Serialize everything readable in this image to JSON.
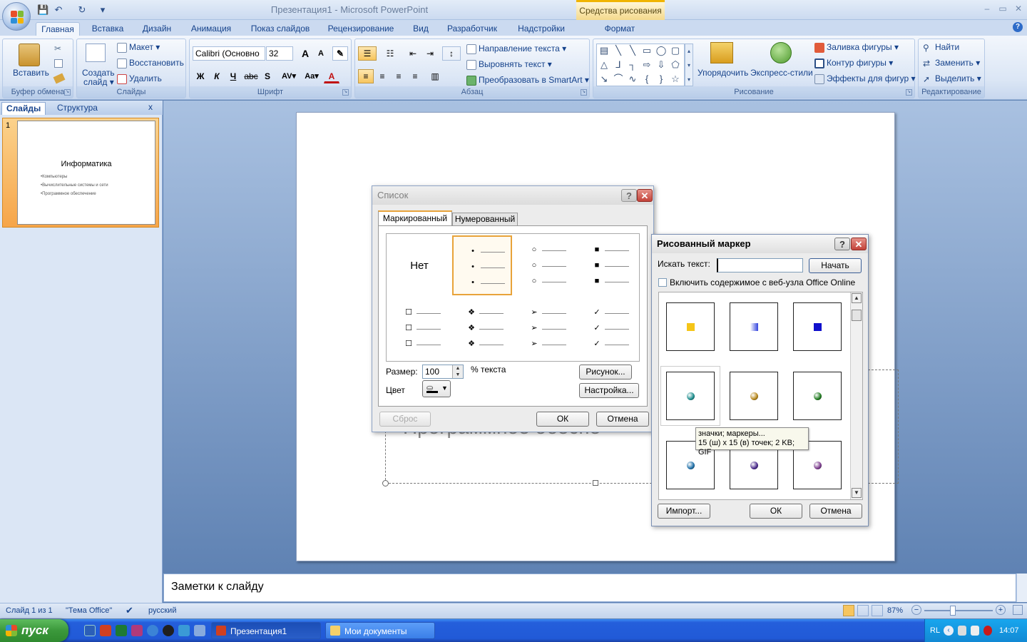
{
  "app": {
    "title": "Презентация1 - Microsoft PowerPoint",
    "context_tab": "Средства рисования",
    "win_min": "–",
    "win_max": "▭",
    "win_close": "✕",
    "help": "?"
  },
  "qat": {
    "save": "💾",
    "undo": "↶",
    "redo": "↻",
    "more": "▾"
  },
  "tabs": [
    {
      "label": "Главная",
      "active": true
    },
    {
      "label": "Вставка"
    },
    {
      "label": "Дизайн"
    },
    {
      "label": "Анимация"
    },
    {
      "label": "Показ слайдов"
    },
    {
      "label": "Рецензирование"
    },
    {
      "label": "Вид"
    },
    {
      "label": "Разработчик"
    },
    {
      "label": "Надстройки"
    },
    {
      "label": "Формат"
    }
  ],
  "ribbon": {
    "clipboard": {
      "label": "Буфер обмена",
      "paste": "Вставить"
    },
    "slides": {
      "label": "Слайды",
      "new_slide": "Создать",
      "new_slide2": "слайд ▾",
      "layout": "Макет ▾",
      "reset": "Восстановить",
      "delete": "Удалить"
    },
    "font": {
      "label": "Шрифт",
      "font_name": "Calibri (Основно",
      "font_size": "32",
      "bold": "Ж",
      "italic": "К",
      "underline": "Ч",
      "strike": "abc",
      "shadow": "S",
      "spacing": "AV▾",
      "case": "Aa▾",
      "color": "A",
      "grow": "A",
      "shrink": "A"
    },
    "paragraph": {
      "label": "Абзац",
      "text_direction": "Направление текста ▾",
      "align_text": "Выровнять текст ▾",
      "smartart": "Преобразовать в SmartArt ▾"
    },
    "drawing": {
      "label": "Рисование",
      "arrange": "Упорядочить",
      "quick_styles": "Экспресс-стили",
      "shape_fill": "Заливка фигуры ▾",
      "shape_outline": "Контур фигуры ▾",
      "shape_effects": "Эффекты для фигур ▾"
    },
    "editing": {
      "label": "Редактирование",
      "find": "Найти",
      "replace": "Заменить ▾",
      "select": "Выделить ▾"
    }
  },
  "left_panel": {
    "tab_slides": "Слайды",
    "tab_outline": "Структура",
    "close": "x",
    "slide_number": "1",
    "thumb_title": "Информатика",
    "thumb_bullets": [
      "•Компьютеры",
      "•Вычислительные системы и сети",
      "•Программное обеспечение"
    ]
  },
  "slide": {
    "visible_text": "Программное обеспе"
  },
  "notes": {
    "placeholder": "Заметки к слайду"
  },
  "status": {
    "slide": "Слайд 1 из 1",
    "theme": "\"Тема Office\"",
    "language": "русский",
    "zoom": "87%",
    "zoom_minus": "−",
    "zoom_plus": "+"
  },
  "bullets_dialog": {
    "title": "Список",
    "help": "?",
    "close": "✕",
    "tab_bulleted": "Маркированный",
    "tab_numbered": "Нумерованный",
    "none_label": "Нет",
    "cells": [
      {
        "symbol": "",
        "none": true
      },
      {
        "symbol": "•",
        "selected": true
      },
      {
        "symbol": "○"
      },
      {
        "symbol": "■"
      },
      {
        "symbol": "☐"
      },
      {
        "symbol": "❖"
      },
      {
        "symbol": "➢"
      },
      {
        "symbol": "✓"
      }
    ],
    "size_label": "Размер:",
    "size_value": "100",
    "size_suffix": "% текста",
    "color_label": "Цвет",
    "picture_btn": "Рисунок...",
    "customize_btn": "Настройка...",
    "reset_btn": "Сброс",
    "ok": "ОК",
    "cancel": "Отмена"
  },
  "picture_dialog": {
    "title": "Рисованный маркер",
    "help": "?",
    "close": "✕",
    "search_label": "Искать текст:",
    "search_value": "",
    "go": "Начать",
    "online_label": "Включить содержимое с веб-узла Office Online",
    "items": [
      {
        "color": "#f5c518",
        "shape": "square"
      },
      {
        "color": "#3344dd",
        "shape": "square-gradient"
      },
      {
        "color": "#1010cc",
        "shape": "square"
      },
      {
        "color": "#1b8c8c",
        "shape": "ball"
      },
      {
        "color": "#b7871a",
        "shape": "ball"
      },
      {
        "color": "#1e7a1e",
        "shape": "ball"
      },
      {
        "color": "#1e6fa8",
        "shape": "ball"
      },
      {
        "color": "#4a2a8c",
        "shape": "ball"
      },
      {
        "color": "#7a3a8c",
        "shape": "ball"
      }
    ],
    "tooltip_line1": "значки; маркеры...",
    "tooltip_line2": "15 (ш) x 15 (в) точек; 2 KB; GIF",
    "import": "Импорт...",
    "ok": "ОК",
    "cancel": "Отмена"
  },
  "taskbar": {
    "start": "пуск",
    "windows": [
      {
        "label": "Презентация1",
        "active": true
      },
      {
        "label": "Мои документы"
      }
    ],
    "lang": "RL",
    "clock": "14:07"
  }
}
